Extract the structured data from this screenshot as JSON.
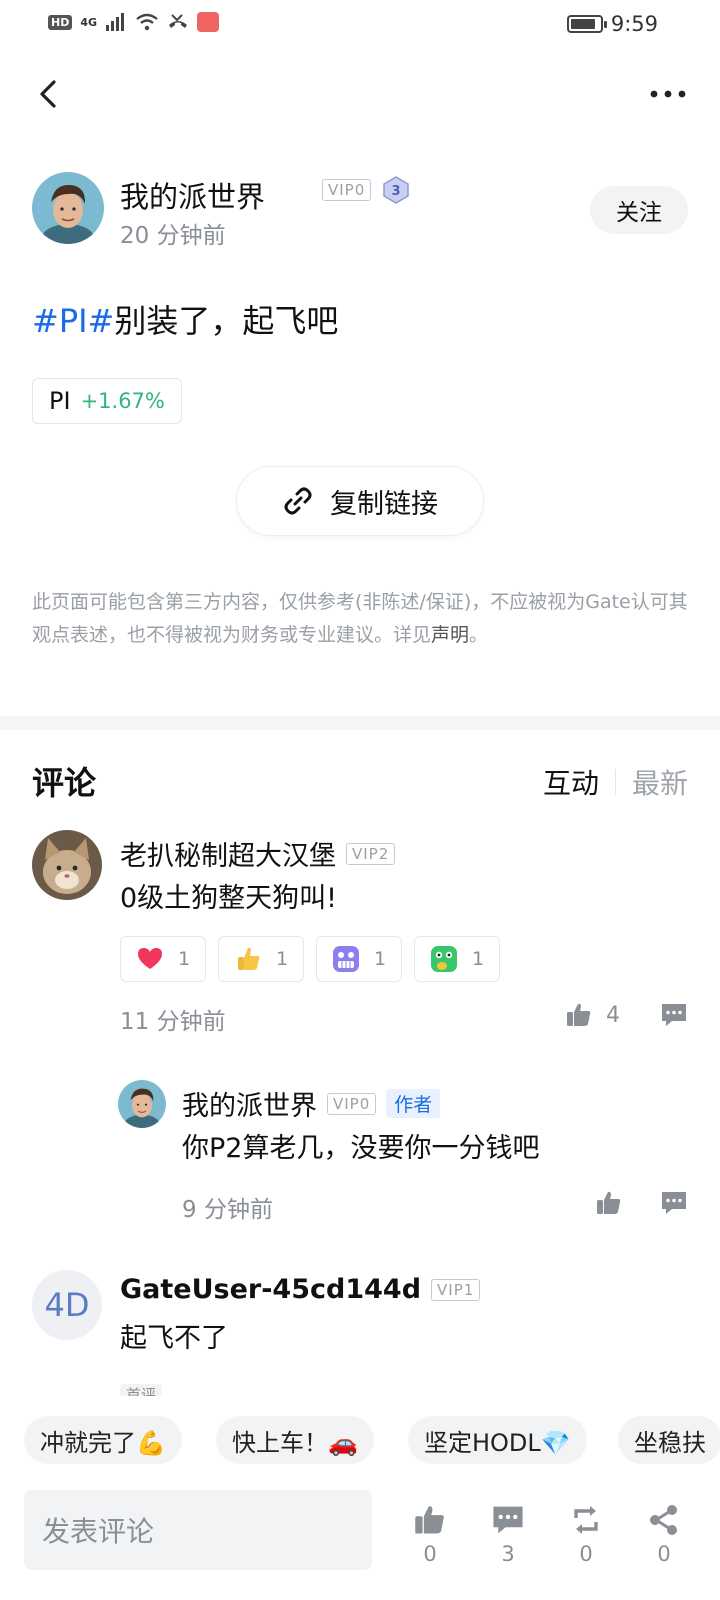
{
  "status_bar": {
    "hd": "HD",
    "network": "4G",
    "time": "9:59",
    "battery_level": 0.85
  },
  "nav": {
    "back_icon": "chevron-left-icon",
    "more_icon": "more-horizontal-icon"
  },
  "post": {
    "author": {
      "name": "我的派世界",
      "vip": "VIP0",
      "level": "3",
      "time": "20 分钟前",
      "follow_label": "关注"
    },
    "hashtag": "#PI#",
    "text": "别装了，起飞吧",
    "coin": {
      "symbol": "PI",
      "change": "+1.67%"
    },
    "copy_link_label": "复制链接",
    "disclaimer_text": "此页面可能包含第三方内容，仅供参考(非陈述/保证)，不应被视为Gate认可其观点表述，也不得被视为财务或专业建议。详见",
    "disclaimer_link": "声明",
    "disclaimer_end": "。"
  },
  "comments_section": {
    "title": "评论",
    "sort_active": "互动",
    "sort_inactive": "最新",
    "comments": [
      {
        "name": "老扒秘制超大汉堡",
        "vip": "VIP2",
        "text": "0级土狗整天狗叫!",
        "reactions": [
          {
            "icon": "heart-icon",
            "count": "1"
          },
          {
            "icon": "thumbs-up-emoji-icon",
            "count": "1"
          },
          {
            "icon": "grimace-emoji-icon",
            "count": "1"
          },
          {
            "icon": "thinking-emoji-icon",
            "count": "1"
          }
        ],
        "time": "11 分钟前",
        "likes": "4",
        "reply": {
          "name": "我的派世界",
          "vip": "VIP0",
          "author_tag": "作者",
          "text": "你P2算老几，没要你一分钱吧",
          "time": "9 分钟前"
        }
      },
      {
        "avatar_text": "4D",
        "name": "GateUser-45cd144d",
        "vip": "VIP1",
        "text": "起飞不了",
        "tag": "首评"
      }
    ]
  },
  "quick_replies": [
    "冲就完了💪",
    "快上车！🚗",
    "坚定HODL💎",
    "坐稳扶"
  ],
  "bottom_bar": {
    "compose_placeholder": "发表评论",
    "likes": "0",
    "comments": "3",
    "reposts": "0",
    "shares": "0"
  }
}
